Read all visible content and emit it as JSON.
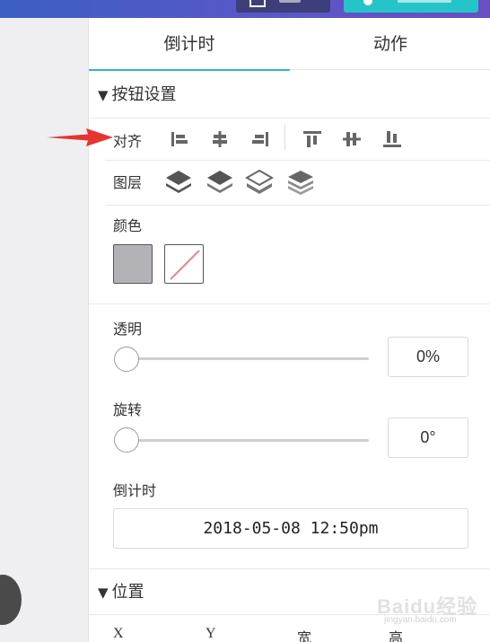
{
  "tabs": [
    {
      "label": "倒计时",
      "active": true
    },
    {
      "label": "动作",
      "active": false
    }
  ],
  "button_settings": {
    "title": "按钮设置",
    "align_label": "对齐",
    "layer_label": "图层",
    "color_label": "颜色",
    "opacity_label": "透明",
    "opacity_value": "0%",
    "opacity_fraction": 0,
    "rotation_label": "旋转",
    "rotation_value": "0°",
    "rotation_fraction": 0,
    "countdown_label": "倒计时",
    "countdown_value": "2018-05-08 12:50pm",
    "fill_color": "#b3b2b7"
  },
  "position": {
    "title": "位置",
    "x_label": "X",
    "y_label": "Y",
    "width_label": "宽",
    "height_label": "高"
  },
  "align_icons": [
    "align-left-icon",
    "align-center-h-icon",
    "align-right-icon",
    "align-top-icon",
    "align-middle-v-icon",
    "align-bottom-icon"
  ],
  "layer_icons": [
    "bring-to-front-icon",
    "bring-forward-icon",
    "send-backward-icon",
    "send-to-back-icon"
  ],
  "colors": {
    "accent": "#2bb8c4",
    "annotation_arrow": "#e8342f"
  },
  "watermark": {
    "brand": "Baidu经验",
    "url": "jingyan.baidu.com"
  }
}
